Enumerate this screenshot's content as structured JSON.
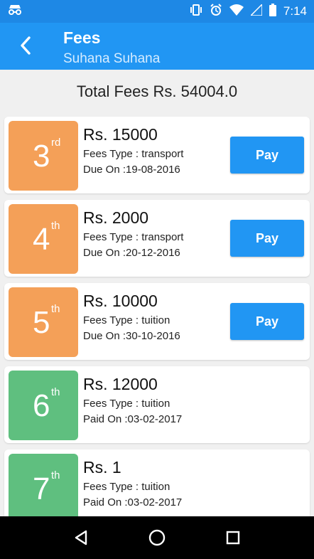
{
  "status_bar": {
    "time": "7:14"
  },
  "app_bar": {
    "title": "Fees",
    "subtitle": "Suhana Suhana"
  },
  "total": "Total Fees Rs. 54004.0",
  "colors": {
    "accent": "#2196f3",
    "unpaid_badge": "#f4a058",
    "paid_badge": "#5fbf7f"
  },
  "cards": [
    {
      "num": "3",
      "sup": "rd",
      "amount": "Rs. 15000",
      "type": "Fees Type :  transport",
      "date": "Due On :19-08-2016",
      "status": "unpaid",
      "pay_label": "Pay"
    },
    {
      "num": "4",
      "sup": "th",
      "amount": "Rs. 2000",
      "type": "Fees Type :  transport",
      "date": "Due On :20-12-2016",
      "status": "unpaid",
      "pay_label": "Pay"
    },
    {
      "num": "5",
      "sup": "th",
      "amount": "Rs. 10000",
      "type": "Fees Type :  tuition",
      "date": "Due On :30-10-2016",
      "status": "unpaid",
      "pay_label": "Pay"
    },
    {
      "num": "6",
      "sup": "th",
      "amount": "Rs. 12000",
      "type": "Fees Type :  tuition",
      "date": "Paid On :03-02-2017",
      "status": "paid"
    },
    {
      "num": "7",
      "sup": "th",
      "amount": "Rs. 1",
      "type": "Fees Type :  tuition",
      "date": "Paid On :03-02-2017",
      "status": "paid"
    }
  ]
}
